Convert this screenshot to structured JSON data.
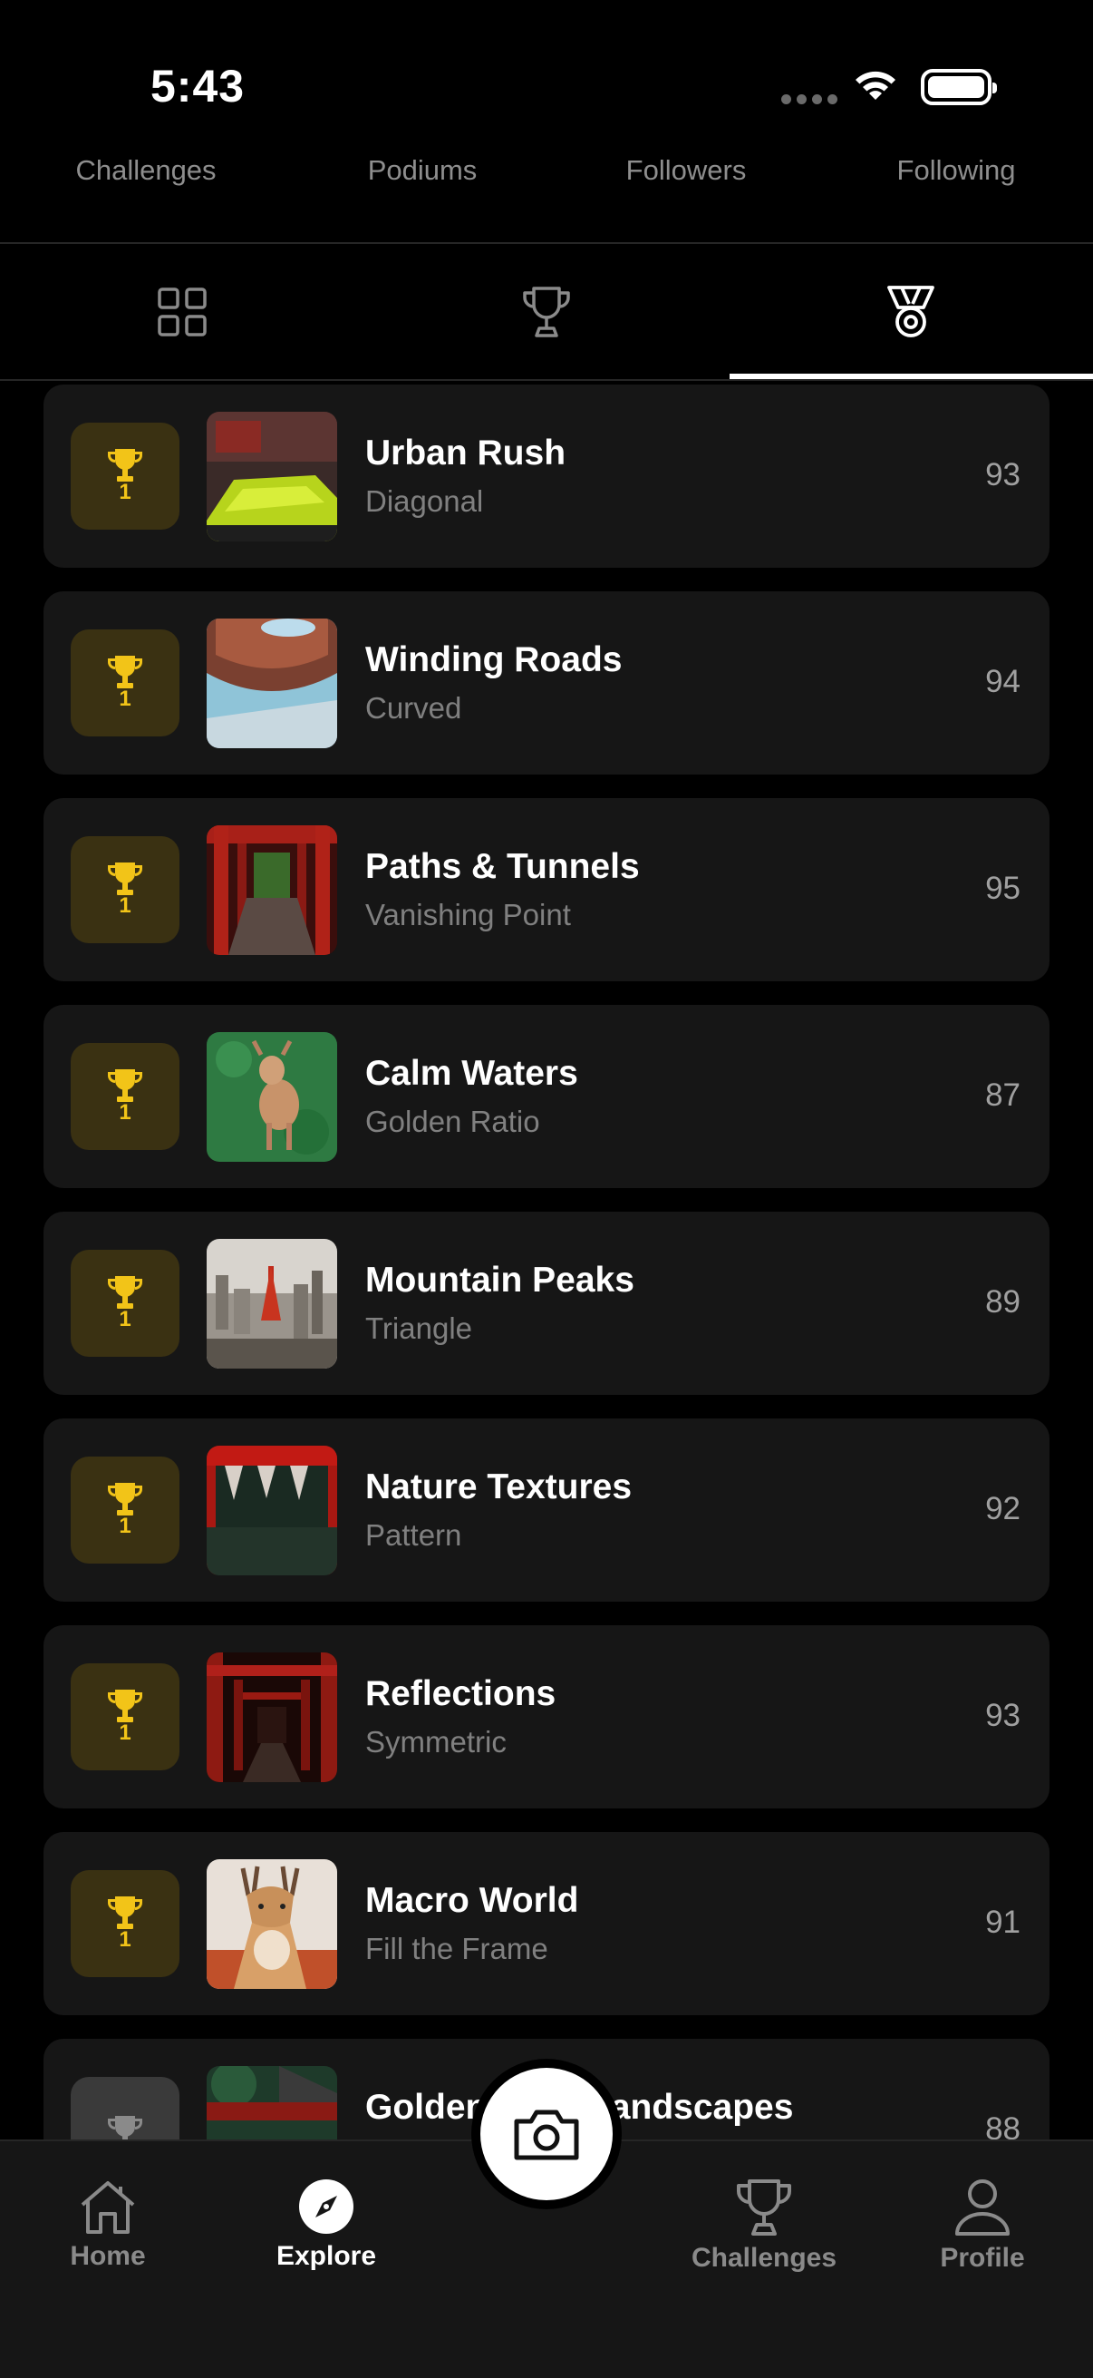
{
  "status": {
    "time": "5:43"
  },
  "stats": [
    {
      "label": "Challenges"
    },
    {
      "label": "Podiums"
    },
    {
      "label": "Followers"
    },
    {
      "label": "Following"
    }
  ],
  "tabs": [
    {
      "icon": "grid-icon"
    },
    {
      "icon": "trophy-outline-icon"
    },
    {
      "icon": "medal-icon",
      "active": true
    }
  ],
  "items": [
    {
      "rank": "1",
      "title": "Urban Rush",
      "subtitle": "Diagonal",
      "score": "93"
    },
    {
      "rank": "1",
      "title": "Winding Roads",
      "subtitle": "Curved",
      "score": "94"
    },
    {
      "rank": "1",
      "title": "Paths & Tunnels",
      "subtitle": "Vanishing Point",
      "score": "95"
    },
    {
      "rank": "1",
      "title": "Calm Waters",
      "subtitle": "Golden Ratio",
      "score": "87"
    },
    {
      "rank": "1",
      "title": "Mountain Peaks",
      "subtitle": "Triangle",
      "score": "89"
    },
    {
      "rank": "1",
      "title": "Nature Textures",
      "subtitle": "Pattern",
      "score": "92"
    },
    {
      "rank": "1",
      "title": "Reflections",
      "subtitle": "Symmetric",
      "score": "93"
    },
    {
      "rank": "1",
      "title": "Macro World",
      "subtitle": "Fill the Frame",
      "score": "91"
    },
    {
      "rank": "",
      "title": "Golden Hour Landscapes",
      "subtitle": "",
      "score": "88"
    }
  ],
  "nav": {
    "home": "Home",
    "explore": "Explore",
    "challenges": "Challenges",
    "profile": "Profile"
  },
  "colors": {
    "gold": "#f2c418",
    "gold_badge_bg": "#3a3112",
    "card_bg": "#161616"
  }
}
